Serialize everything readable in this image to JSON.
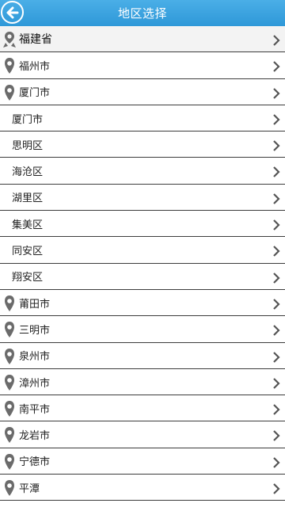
{
  "header": {
    "title": "地区选择",
    "back_icon": "back-arrow-icon"
  },
  "province": {
    "label": "福建省",
    "icon": "person-pin-icon"
  },
  "rows": [
    {
      "label": "福州市",
      "type": "city"
    },
    {
      "label": "厦门市",
      "type": "city"
    },
    {
      "label": "厦门市",
      "type": "district"
    },
    {
      "label": "思明区",
      "type": "district"
    },
    {
      "label": "海沧区",
      "type": "district"
    },
    {
      "label": "湖里区",
      "type": "district"
    },
    {
      "label": "集美区",
      "type": "district"
    },
    {
      "label": "同安区",
      "type": "district"
    },
    {
      "label": "翔安区",
      "type": "district"
    },
    {
      "label": "莆田市",
      "type": "city"
    },
    {
      "label": "三明市",
      "type": "city"
    },
    {
      "label": "泉州市",
      "type": "city"
    },
    {
      "label": "漳州市",
      "type": "city"
    },
    {
      "label": "南平市",
      "type": "city"
    },
    {
      "label": "龙岩市",
      "type": "city"
    },
    {
      "label": "宁德市",
      "type": "city"
    },
    {
      "label": "平潭",
      "type": "city"
    }
  ],
  "colors": {
    "header_bg": "#3aa3e0",
    "divider": "#3c3c3c",
    "icon_gray": "#6b6b6b"
  }
}
